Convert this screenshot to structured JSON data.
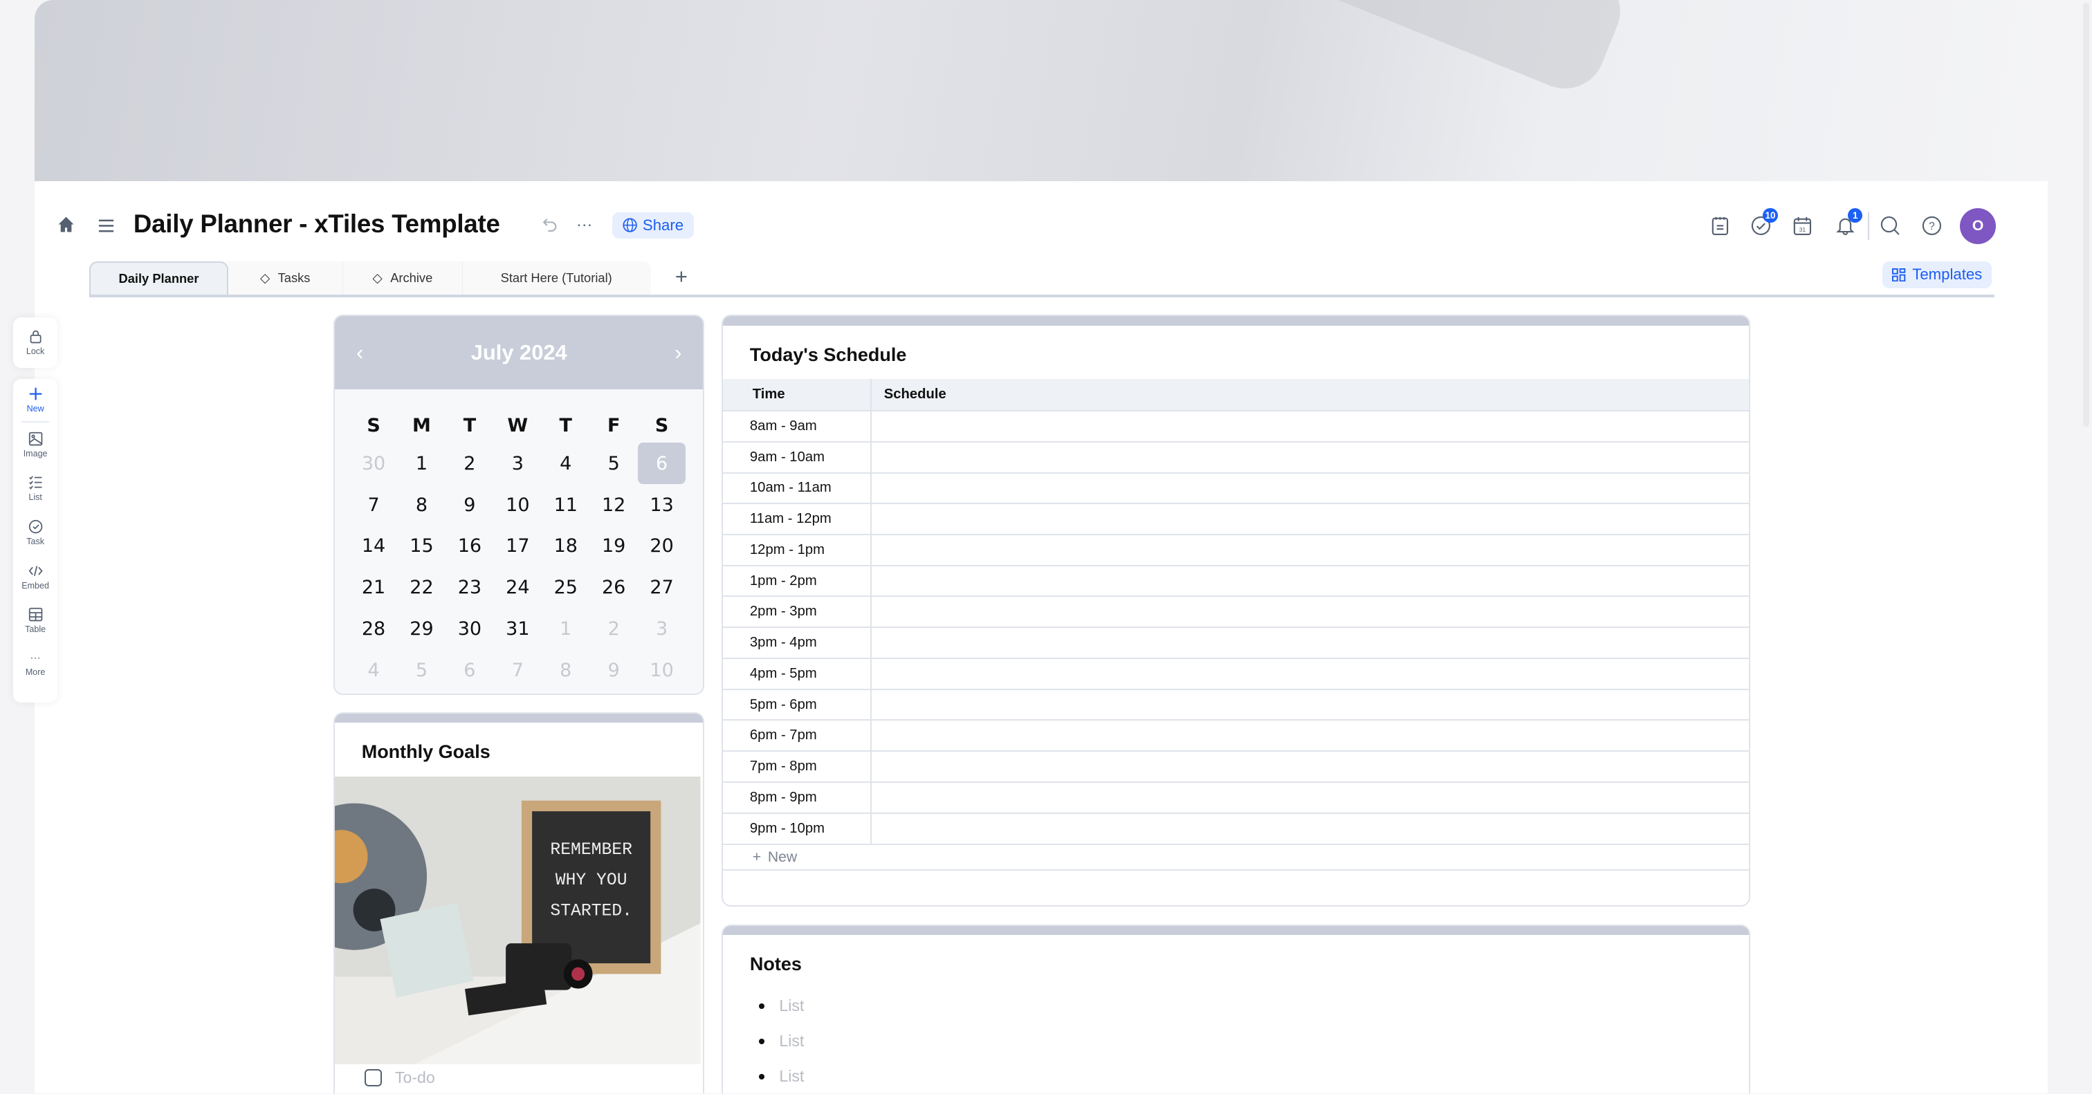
{
  "header": {
    "title": "Daily Planner - xTiles Template",
    "share_label": "Share",
    "tasks_badge": "10",
    "notifications_badge": "1",
    "avatar_initial": "O",
    "templates_label": "Templates"
  },
  "tabs": [
    {
      "label": "Daily Planner"
    },
    {
      "label": "Tasks"
    },
    {
      "label": "Archive"
    },
    {
      "label": "Start Here (Tutorial)"
    }
  ],
  "toolbar": {
    "lock": "Lock",
    "new": "New",
    "image": "Image",
    "list": "List",
    "task": "Task",
    "embed": "Embed",
    "table": "Table",
    "more": "More"
  },
  "calendar": {
    "month": "July 2024",
    "weekdays": [
      "S",
      "M",
      "T",
      "W",
      "T",
      "F",
      "S"
    ],
    "days": [
      [
        "30",
        1
      ],
      [
        "1",
        0
      ],
      [
        "2",
        0
      ],
      [
        "3",
        0
      ],
      [
        "4",
        0
      ],
      [
        "5",
        0
      ],
      [
        "6",
        2
      ],
      [
        "7",
        0
      ],
      [
        "8",
        0
      ],
      [
        "9",
        0
      ],
      [
        "10",
        0
      ],
      [
        "11",
        0
      ],
      [
        "12",
        0
      ],
      [
        "13",
        0
      ],
      [
        "14",
        0
      ],
      [
        "15",
        0
      ],
      [
        "16",
        0
      ],
      [
        "17",
        0
      ],
      [
        "18",
        0
      ],
      [
        "19",
        0
      ],
      [
        "20",
        0
      ],
      [
        "21",
        0
      ],
      [
        "22",
        0
      ],
      [
        "23",
        0
      ],
      [
        "24",
        0
      ],
      [
        "25",
        0
      ],
      [
        "26",
        0
      ],
      [
        "27",
        0
      ],
      [
        "28",
        0
      ],
      [
        "29",
        0
      ],
      [
        "30",
        0
      ],
      [
        "31",
        0
      ],
      [
        "1",
        1
      ],
      [
        "2",
        1
      ],
      [
        "3",
        1
      ],
      [
        "4",
        1
      ],
      [
        "5",
        1
      ],
      [
        "6",
        1
      ],
      [
        "7",
        1
      ],
      [
        "8",
        1
      ],
      [
        "9",
        1
      ],
      [
        "10",
        1
      ]
    ]
  },
  "goals": {
    "title": "Monthly Goals",
    "image_text": [
      "REMEMBER",
      "WHY YOU",
      "STARTED."
    ],
    "todo_placeholder": "To-do"
  },
  "schedule": {
    "title": "Today's Schedule",
    "columns": [
      "Time",
      "Schedule"
    ],
    "rows": [
      "8am - 9am",
      "9am - 10am",
      "10am - 11am",
      "11am - 12pm",
      "12pm - 1pm",
      "1pm - 2pm",
      "2pm - 3pm",
      "3pm - 4pm",
      "4pm - 5pm",
      "5pm - 6pm",
      "6pm - 7pm",
      "7pm - 8pm",
      "8pm - 9pm",
      "9pm - 10pm"
    ],
    "new_label": "New"
  },
  "notes": {
    "title": "Notes",
    "items": [
      "List",
      "List",
      "List"
    ]
  }
}
